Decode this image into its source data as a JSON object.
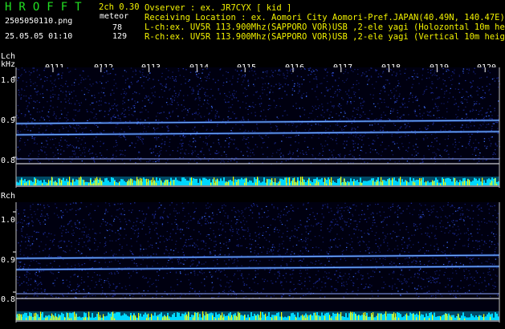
{
  "app": {
    "logo": "HROFFT",
    "version": "2ch 0.30",
    "filename": "2505050110.png",
    "mode_label": "meteor",
    "datetime": "25.05.05 01:10",
    "lch_count": "78",
    "rch_count": "129"
  },
  "info": {
    "observer": "Ovserver              : ex. JR7CYX [ kid ]",
    "location": "Receiving Location : ex. Aomori City Aomori-Pref.JAPAN(40.49N, 140.47E)",
    "lch": "L-ch:ex. UV5R 113.900Mhz(SAPPORO VOR)USB ,2-ele yagi (Holozontal 10m height)",
    "rch": "R-ch:ex. UV5R 113.900Mhz(SAPPORO VOR)USB ,2-ele yagi (Vertical 10m height)"
  },
  "panels": {
    "lch": {
      "label": "Lch",
      "unit": "kHz"
    },
    "rch": {
      "label": "Rch"
    },
    "y_ticks": [
      "1.0",
      "0.9",
      "0.8"
    ]
  },
  "time_ticks": [
    "0111",
    "0112",
    "0113",
    "0114",
    "0115",
    "0116",
    "0117",
    "0118",
    "0119",
    "0120"
  ],
  "colors": {
    "background": "#000000",
    "logo": "#22e022",
    "header_text": "#f2f200",
    "grid": "#ffffff",
    "spectrum_noise": "#1a2a9a",
    "signal_line": "#6fb0ff",
    "level_cyan": "#00d8ff",
    "level_yellow": "#ffff00"
  }
}
